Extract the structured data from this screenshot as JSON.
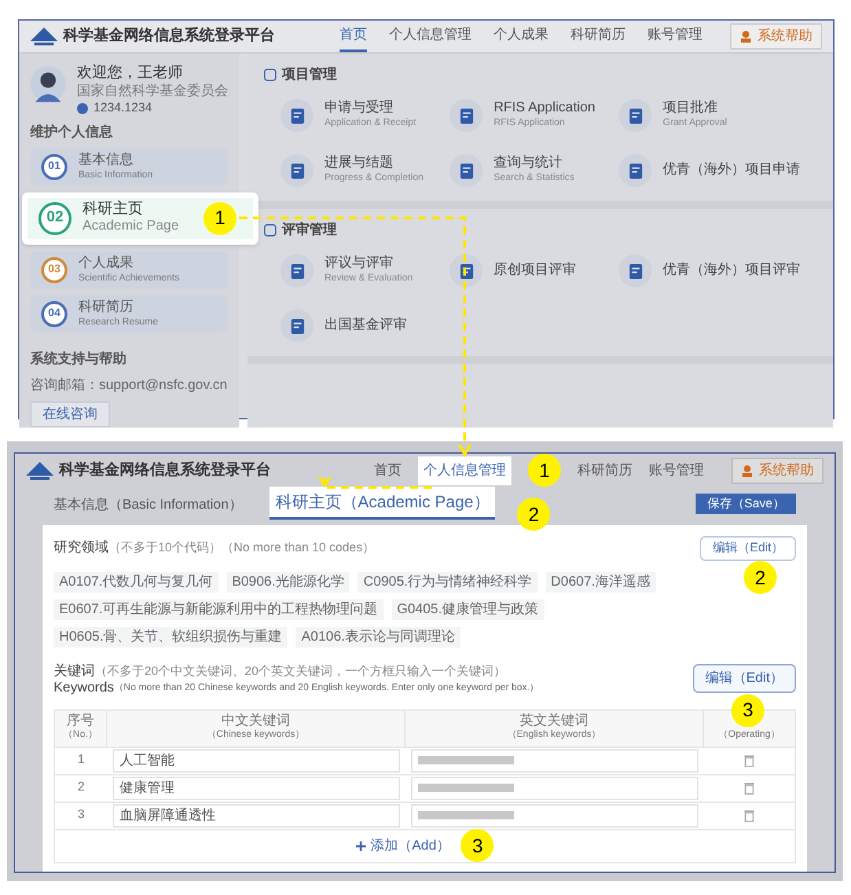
{
  "overview_screen": {
    "title": "科学基金网络信息系统登录平台",
    "nav": [
      {
        "label": "首页",
        "selected": true
      },
      {
        "label": "个人信息管理",
        "selected": false
      },
      {
        "label": "个人成果",
        "selected": false
      },
      {
        "label": "科研简历",
        "selected": false
      },
      {
        "label": "账号管理",
        "selected": false
      }
    ],
    "nav_button": "系统帮助",
    "profile": {
      "greeting": "欢迎您，王老师",
      "org": "国家自然科学基金委员会",
      "phone": "1234.1234"
    },
    "sidebar_heading": "维护个人信息",
    "sidebar_items": [
      {
        "number": "01",
        "title": "基本信息",
        "subtitle": "Basic Information",
        "color": "#4a6fb5",
        "selected": false
      },
      {
        "number": "02",
        "title": "科研主页",
        "subtitle": "Academic Page",
        "color": "#2aa37a",
        "selected": true
      },
      {
        "number": "03",
        "title": "个人成果",
        "subtitle": "Scientific Achievements",
        "color": "#d08a3a",
        "selected": false
      },
      {
        "number": "04",
        "title": "科研简历",
        "subtitle": "Research Resume",
        "color": "#4a6fb5",
        "selected": false
      }
    ],
    "support": {
      "heading": "系统支持与帮助",
      "email": "咨询邮箱：support@nsfc.gov.cn",
      "button": "在线咨询"
    },
    "sections": [
      {
        "title": "项目管理",
        "items": [
          {
            "title": "申请与受理",
            "subtitle": "Application & Receipt"
          },
          {
            "title": "RFIS Application",
            "subtitle": "RFIS Application"
          },
          {
            "title": "项目批准",
            "subtitle": "Grant Approval"
          },
          {
            "title": "进展与结题",
            "subtitle": "Progress & Completion"
          },
          {
            "title": "查询与统计",
            "subtitle": "Search & Statistics"
          },
          {
            "title": "优青（海外）项目申请"
          }
        ]
      },
      {
        "title": "评审管理",
        "items": [
          {
            "title": "评议与评审",
            "subtitle": "Review & Evaluation"
          },
          {
            "title": "原创项目评审"
          },
          {
            "title": "优青（海外）项目评审"
          },
          {
            "title": "出国基金评审"
          }
        ]
      }
    ]
  },
  "detail_screen": {
    "title": "科学基金网络信息系统登录平台",
    "nav": [
      {
        "label": "首页",
        "selected": false
      },
      {
        "label": "个人信息管理",
        "selected": true
      },
      {
        "label": "科研简历",
        "selected": false
      },
      {
        "label": "账号管理",
        "selected": false
      }
    ],
    "nav_button": "系统帮助",
    "tabs": [
      {
        "label": "基本信息（Basic Information）",
        "selected": false
      },
      {
        "label": "科研主页（Academic Page）",
        "selected": true
      }
    ],
    "save_button": "保存（Save）",
    "research_fields": {
      "heading": "研究领域",
      "note": "（不多于10个代码）（No more than 10 codes）",
      "edit_button": "编辑（Edit）",
      "tags": [
        "A0107.代数几何与复几何",
        "B0906.光能源化学",
        "C0905.行为与情绪神经科学",
        "D0607.海洋遥感",
        "E0607.可再生能源与新能源利用中的工程热物理问题",
        "G0405.健康管理与政策",
        "H0605.骨、关节、软组织损伤与重建",
        "A0106.表示论与同调理论"
      ]
    },
    "keywords": {
      "heading": "关键词",
      "note": "（不多于20个中文关键词、20个英文关键词，一个方框只输入一个关键词）",
      "heading_en": "Keywords",
      "note_en": "（No more than 20 Chinese keywords and 20 English keywords. Enter only one keyword per box.）",
      "edit_button": "编辑（Edit）",
      "columns": [
        {
          "title": "序号",
          "subtitle": "（No.）"
        },
        {
          "title": "中文关键词",
          "subtitle": "（Chinese keywords）"
        },
        {
          "title": "英文关键词",
          "subtitle": "（English keywords）"
        },
        {
          "subtitle": "（Operating）"
        }
      ],
      "rows": [
        {
          "no": "1",
          "chinese": "人工智能"
        },
        {
          "no": "2",
          "chinese": "健康管理"
        },
        {
          "no": "3",
          "chinese": "血脑屏障通透性"
        }
      ],
      "add_button": "添加（Add）"
    }
  },
  "callouts": [
    "1",
    "1",
    "2",
    "2",
    "3",
    "3"
  ]
}
